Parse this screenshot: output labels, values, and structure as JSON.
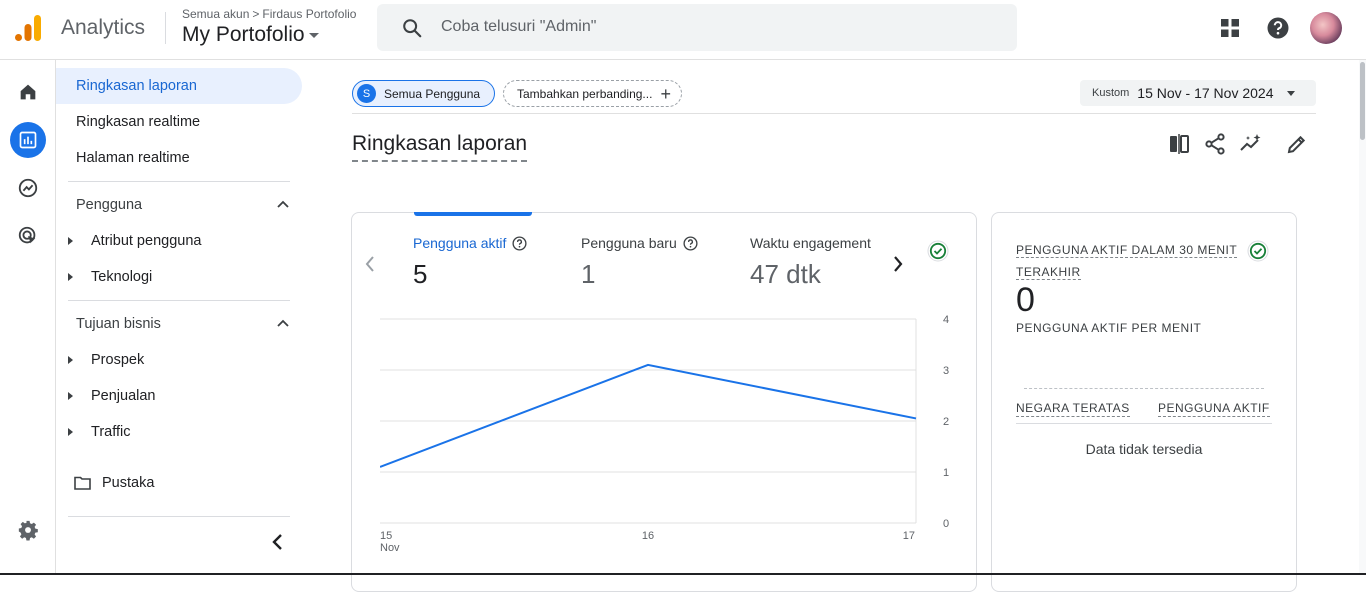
{
  "header": {
    "app_title": "Analytics",
    "breadcrumb": {
      "account_scope": "Semua akun",
      "account": "Firdaus Portofolio"
    },
    "property": "My Portofolio",
    "search_placeholder": "Coba telusuri \"Admin\"",
    "icons": [
      "apps-grid-icon",
      "help-icon",
      "avatar"
    ]
  },
  "rail": {
    "items": [
      {
        "name": "home",
        "icon": "home-icon",
        "active": false
      },
      {
        "name": "reports",
        "icon": "bar-chart-icon",
        "active": true
      },
      {
        "name": "explore",
        "icon": "explore-icon",
        "active": false
      },
      {
        "name": "advertising",
        "icon": "target-cursor-icon",
        "active": false
      }
    ],
    "settings_icon": "gear-icon"
  },
  "nav": {
    "top_items": [
      "Ringkasan laporan",
      "Ringkasan realtime",
      "Halaman realtime"
    ],
    "active_item": "Ringkasan laporan",
    "sections": [
      {
        "title": "Pengguna",
        "expanded": true,
        "items": [
          "Atribut pengguna",
          "Teknologi"
        ]
      },
      {
        "title": "Tujuan bisnis",
        "expanded": true,
        "items": [
          "Prospek",
          "Penjualan",
          "Traffic"
        ]
      }
    ],
    "library": "Pustaka"
  },
  "toolbar": {
    "segment_letter": "S",
    "segment_label": "Semua Pengguna",
    "compare_label": "Tambahkan perbanding...",
    "date_prefix": "Kustom",
    "date_range": "15 Nov - 17 Nov 2024"
  },
  "page_title": "Ringkasan laporan",
  "metrics": [
    {
      "label": "Pengguna aktif",
      "value": "5",
      "active": true
    },
    {
      "label": "Pengguna baru",
      "value": "1",
      "active": false
    },
    {
      "label": "Waktu engagement",
      "value": "47 dtk",
      "active": false
    }
  ],
  "chart_data": {
    "type": "line",
    "x": [
      "15 Nov",
      "16",
      "17"
    ],
    "series": [
      {
        "values": [
          1.1,
          3.1,
          2.05
        ]
      }
    ],
    "y_ticks": [
      0,
      1,
      2,
      3,
      4
    ],
    "ylim": [
      0,
      4
    ],
    "grid": true,
    "colors": {
      "line": "#1a73e8",
      "grid": "#e0e0e0"
    }
  },
  "realtime_card": {
    "title": "PENGGUNA AKTIF DALAM 30 MENIT TERAKHIR",
    "title_line1": "PENGGUNA AKTIF DALAM 30 MENIT",
    "title_line2": "TERAKHIR",
    "value": "0",
    "subtitle": "PENGGUNA AKTIF PER MENIT",
    "col_country": "NEGARA TERATAS",
    "col_users": "PENGGUNA AKTIF",
    "empty_text": "Data tidak tersedia"
  },
  "colors": {
    "accent": "#1a73e8",
    "active_bg": "#e8f0fe",
    "check": "#188038",
    "logo_orange": "#f9ab00",
    "logo_dark_orange": "#e37400"
  }
}
